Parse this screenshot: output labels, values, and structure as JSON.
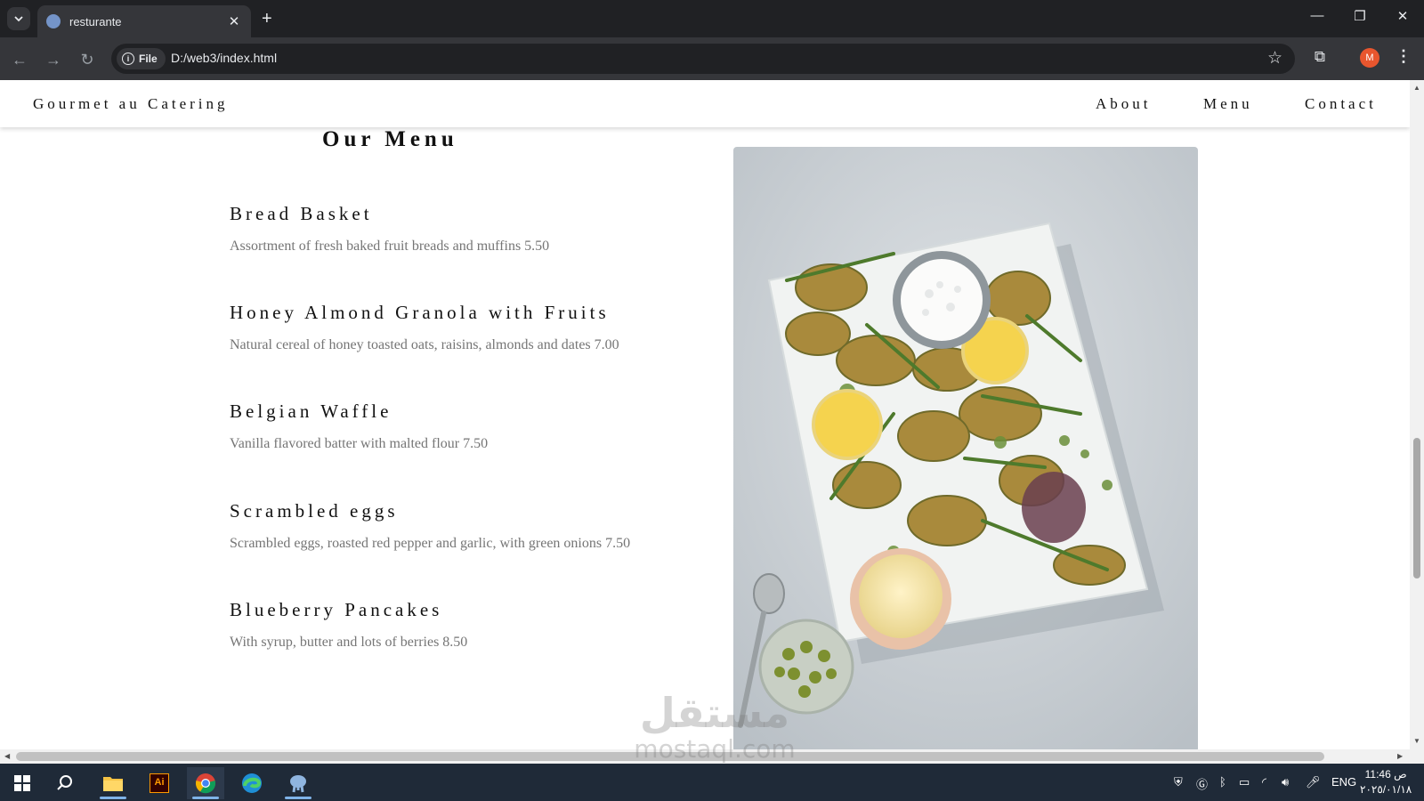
{
  "browser": {
    "tab_title": "resturante",
    "file_chip": "File",
    "url": "D:/web3/index.html",
    "profile_initial": "M"
  },
  "site": {
    "brand": "Gourmet au Catering",
    "nav": [
      "About",
      "Menu",
      "Contact"
    ],
    "menu_title": "Our Menu",
    "items": [
      {
        "name": "Bread Basket",
        "description": "Assortment of fresh baked fruit breads and muffins 5.50"
      },
      {
        "name": "Honey Almond Granola with Fruits",
        "description": "Natural cereal of honey toasted oats, raisins, almonds and dates 7.00"
      },
      {
        "name": "Belgian Waffle",
        "description": "Vanilla flavored batter with malted flour 7.50"
      },
      {
        "name": "Scrambled eggs",
        "description": "Scrambled eggs, roasted red pepper and garlic, with green onions 7.50"
      },
      {
        "name": "Blueberry Pancakes",
        "description": "With syrup, butter and lots of berries 8.50"
      }
    ]
  },
  "taskbar": {
    "illustrator_label": "Ai",
    "language": "ENG",
    "time": "11:46 ص",
    "date": "٢٠٢٥/٠١/١٨"
  },
  "watermark": {
    "arabic": "مستقل",
    "latin": "mostaql.com"
  }
}
